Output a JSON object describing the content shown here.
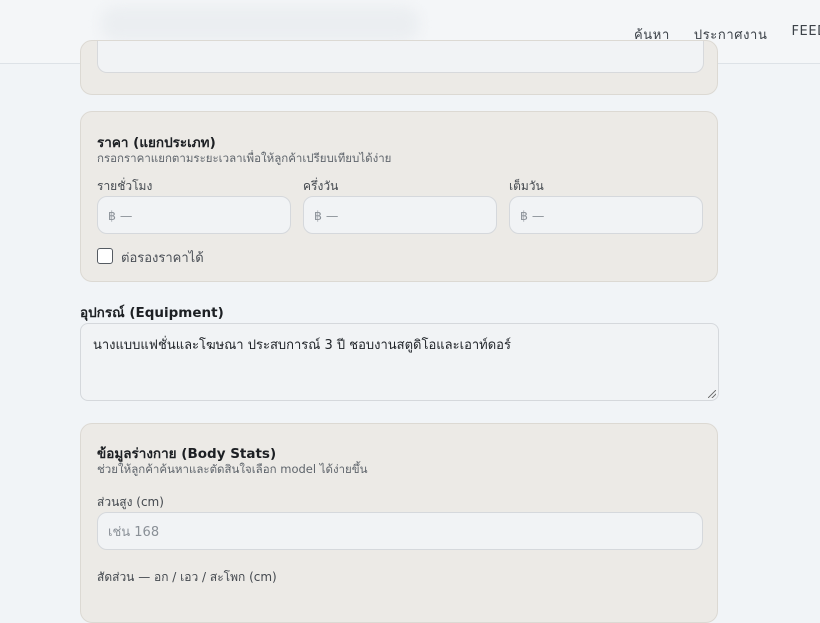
{
  "nav": {
    "items": [
      "ค้นหา",
      "ประกาศงาน",
      "FEED"
    ]
  },
  "price": {
    "title": "ราคา (แยกประเภท)",
    "subtitle": "กรอกราคาแยกตามระยะเวลาเพื่อให้ลูกค้าเปรียบเทียบได้ง่าย",
    "fields": [
      {
        "label": "รายชั่วโมง",
        "value": "฿ —"
      },
      {
        "label": "ครึ่งวัน",
        "value": "฿ —"
      },
      {
        "label": "เต็มวัน",
        "value": "฿ —"
      }
    ],
    "negotiable_label": "ต่อรองราคาได้",
    "negotiable_checked": false
  },
  "equipment": {
    "label": "อุปกรณ์ (Equipment)",
    "value": "นางแบบแฟชั่นและโฆษณา ประสบการณ์ 3 ปี ชอบงานสตูดิโอและเอาท์ดอร์"
  },
  "body_stats": {
    "title": "ข้อมูลร่างกาย (Body Stats)",
    "subtitle": "ช่วยให้ลูกค้าค้นหาและตัดสินใจเลือก model ได้ง่ายขึ้น",
    "height_label": "ส่วนสูง (cm)",
    "height_placeholder": "เช่น 168",
    "measurements_label": "สัดส่วน — อก / เอว / สะโพก (cm)"
  }
}
